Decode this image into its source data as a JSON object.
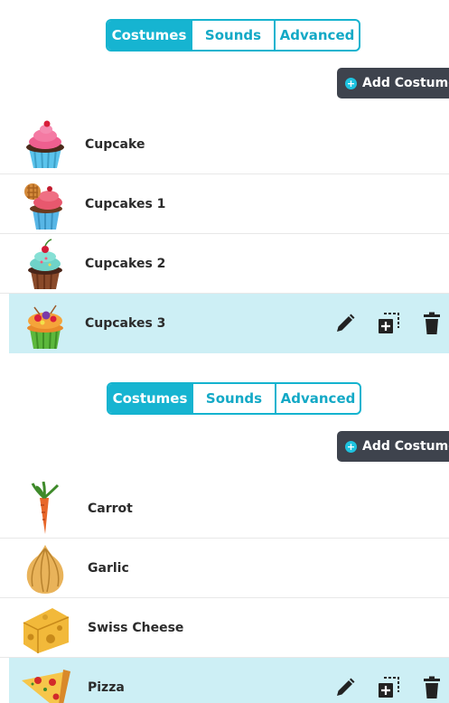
{
  "panels": [
    {
      "tabs": [
        "Costumes",
        "Sounds",
        "Advanced"
      ],
      "active_tab": "Costumes",
      "add_button_label": "Add Costume",
      "items": [
        {
          "name": "Cupcake",
          "icon": "cupcake-pink-icon",
          "selected": false
        },
        {
          "name": "Cupcakes 1",
          "icon": "cupcake-cookie-icon",
          "selected": false
        },
        {
          "name": "Cupcakes 2",
          "icon": "cupcake-mint-icon",
          "selected": false
        },
        {
          "name": "Cupcakes 3",
          "icon": "cupcake-fruit-icon",
          "selected": true
        }
      ]
    },
    {
      "tabs": [
        "Costumes",
        "Sounds",
        "Advanced"
      ],
      "active_tab": "Costumes",
      "add_button_label": "Add Costume",
      "items": [
        {
          "name": "Carrot",
          "icon": "carrot-icon",
          "selected": false
        },
        {
          "name": "Garlic",
          "icon": "garlic-icon",
          "selected": false
        },
        {
          "name": "Swiss Cheese",
          "icon": "swiss-cheese-icon",
          "selected": false
        },
        {
          "name": "Pizza",
          "icon": "pizza-slice-icon",
          "selected": true
        }
      ]
    }
  ],
  "colors": {
    "accent": "#16b4d1",
    "selected_row": "#cdeff5",
    "add_button_bg": "#3e434d"
  }
}
